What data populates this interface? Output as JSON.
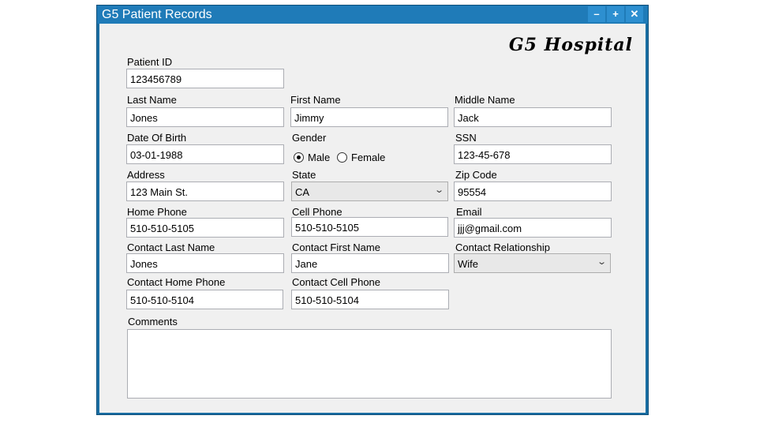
{
  "window": {
    "title": "G5 Patient Records",
    "minimize_glyph": "–",
    "maximize_glyph": "+",
    "close_glyph": "✕"
  },
  "logo": "G5 Hospital",
  "form": {
    "patient_id": {
      "label": "Patient ID",
      "value": "123456789"
    },
    "last_name": {
      "label": "Last Name",
      "value": "Jones"
    },
    "first_name": {
      "label": "First Name",
      "value": "Jimmy"
    },
    "middle_name": {
      "label": "Middle Name",
      "value": "Jack"
    },
    "dob": {
      "label": "Date Of Birth",
      "value": "03-01-1988"
    },
    "gender": {
      "label": "Gender",
      "male": "Male",
      "female": "Female",
      "selected": "Male"
    },
    "ssn": {
      "label": "SSN",
      "value": "123-45-678"
    },
    "address": {
      "label": "Address",
      "value": "123 Main St."
    },
    "state": {
      "label": "State",
      "value": "CA"
    },
    "zip": {
      "label": "Zip Code",
      "value": "95554"
    },
    "home_phone": {
      "label": "Home Phone",
      "value": "510-510-5105"
    },
    "cell_phone": {
      "label": "Cell Phone",
      "value": "510-510-5105"
    },
    "email": {
      "label": "Email",
      "value": "jjj@gmail.com"
    },
    "contact_last_name": {
      "label": "Contact Last Name",
      "value": "Jones"
    },
    "contact_first_name": {
      "label": "Contact First Name",
      "value": "Jane"
    },
    "contact_relationship": {
      "label": "Contact Relationship",
      "value": "Wife"
    },
    "contact_home_phone": {
      "label": "Contact Home Phone",
      "value": "510-510-5104"
    },
    "contact_cell_phone": {
      "label": "Contact Cell Phone",
      "value": "510-510-5104"
    },
    "comments": {
      "label": "Comments",
      "value": ""
    }
  },
  "colors": {
    "titlebar": "#1f7bb8",
    "window_border": "#1a6ea3",
    "client_bg": "#f0f0f0"
  }
}
